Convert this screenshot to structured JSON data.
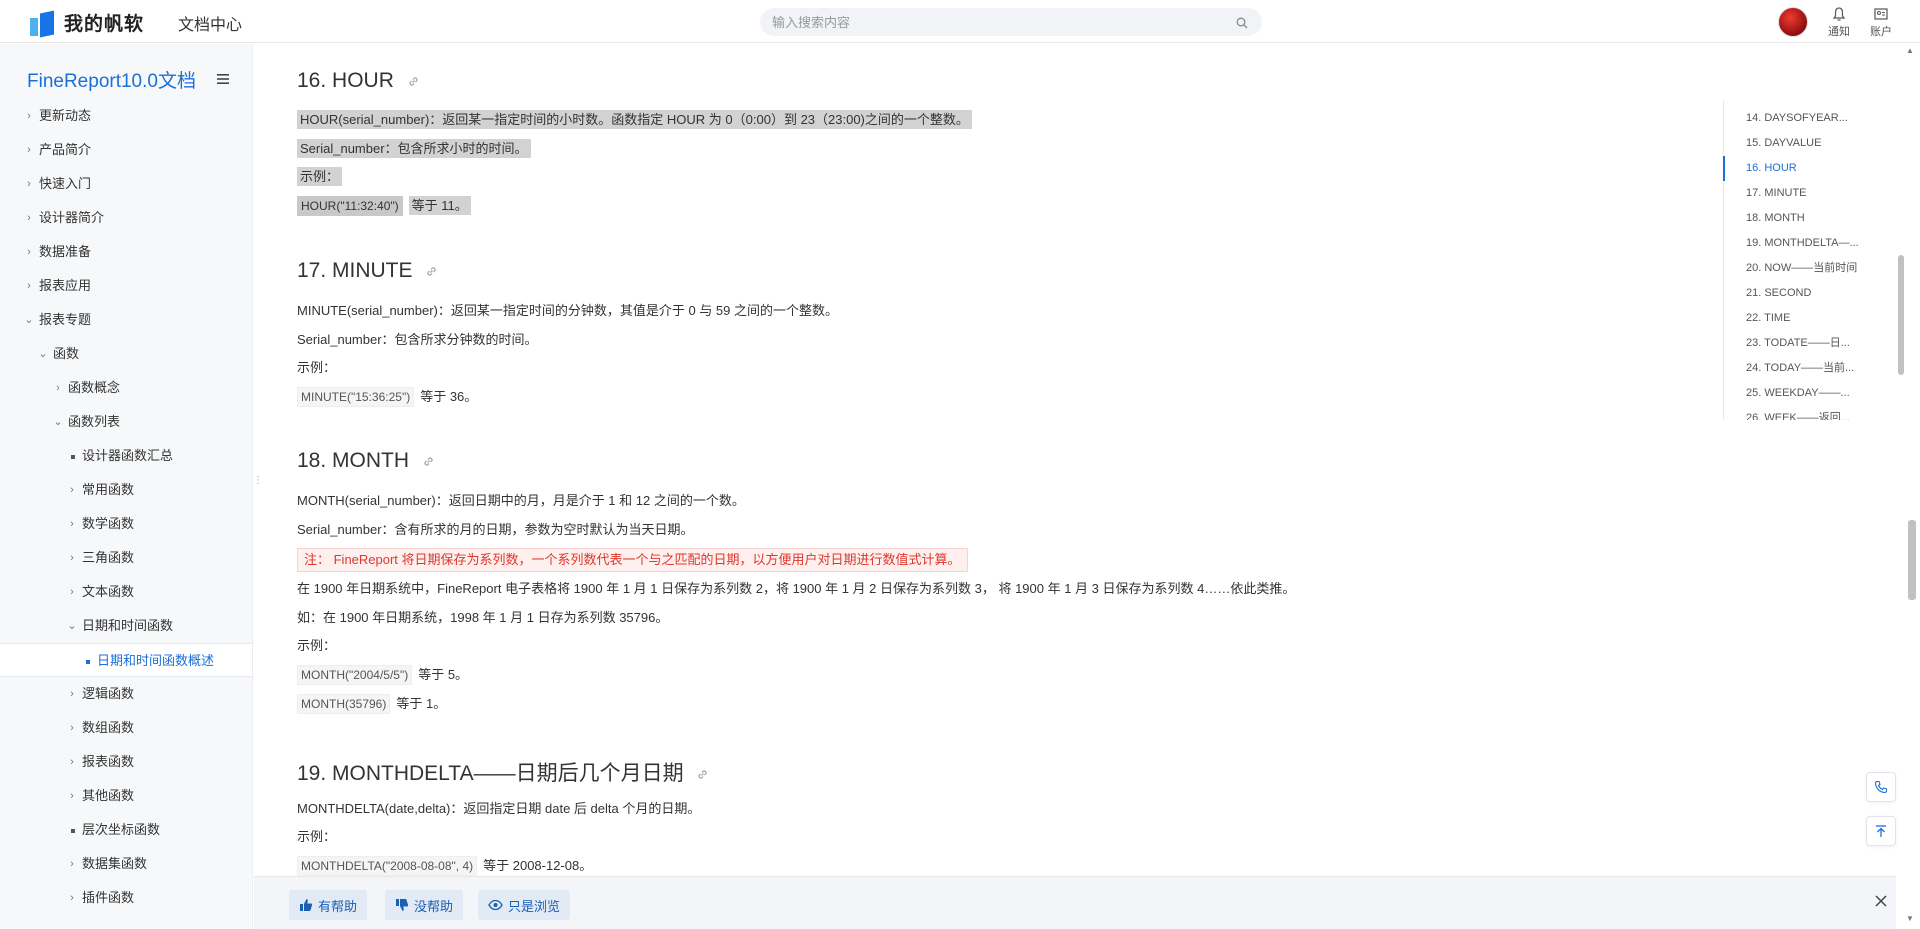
{
  "header": {
    "brand": "我的帆软",
    "section": "文档中心",
    "search_placeholder": "输入搜索内容",
    "notify_label": "通知",
    "account_label": "账户"
  },
  "sidebar": {
    "title": "FineReport10.0文档",
    "items": [
      {
        "label": "更新动态"
      },
      {
        "label": "产品简介"
      },
      {
        "label": "快速入门"
      },
      {
        "label": "设计器简介"
      },
      {
        "label": "数据准备"
      },
      {
        "label": "报表应用"
      },
      {
        "label": "报表专题"
      },
      {
        "label": "函数"
      },
      {
        "label": "函数概念"
      },
      {
        "label": "函数列表"
      },
      {
        "label": "设计器函数汇总"
      },
      {
        "label": "常用函数"
      },
      {
        "label": "数学函数"
      },
      {
        "label": "三角函数"
      },
      {
        "label": "文本函数"
      },
      {
        "label": "日期和时间函数"
      },
      {
        "label": "日期和时间函数概述"
      },
      {
        "label": "逻辑函数"
      },
      {
        "label": "数组函数"
      },
      {
        "label": "报表函数"
      },
      {
        "label": "其他函数"
      },
      {
        "label": "层次坐标函数"
      },
      {
        "label": "数据集函数"
      },
      {
        "label": "插件函数"
      }
    ]
  },
  "content": {
    "hour": {
      "title": "16. HOUR",
      "desc": "HOUR(serial_number)：返回某一指定时间的小时数。函数指定 HOUR 为 0（0:00）到 23（23:00)之间的一个整数。",
      "param": "Serial_number：包含所求小时的时间。",
      "example_label": "示例：",
      "ex1_code": "HOUR(\"11:32:40\")",
      "ex1_result": "等于 11。"
    },
    "minute": {
      "title": "17. MINUTE",
      "desc": "MINUTE(serial_number)：返回某一指定时间的分钟数，其值是介于 0 与 59 之间的一个整数。",
      "param": "Serial_number：包含所求分钟数的时间。",
      "example_label": "示例：",
      "ex1_code": "MINUTE(\"15:36:25\")",
      "ex1_result": "等于 36。"
    },
    "month": {
      "title": "18. MONTH",
      "desc": "MONTH(serial_number)：返回日期中的月，月是介于 1 和 12 之间的一个数。",
      "param": "Serial_number：含有所求的月的日期，参数为空时默认为当天日期。",
      "note": "注：  FineReport 将日期保存为系列数，一个系列数代表一个与之匹配的日期，以方便用户对日期进行数值式计算。",
      "para1": "在 1900 年日期系统中，FineReport 电子表格将 1900 年 1 月 1 日保存为系列数 2，将 1900 年 1 月 2 日保存为系列数 3，  将 1900 年 1 月 3 日保存为系列数 4……依此类推。",
      "para2": "如：在 1900 年日期系统，1998 年 1 月 1 日存为系列数 35796。",
      "example_label": "示例：",
      "ex1_code": "MONTH(\"2004/5/5\")",
      "ex1_result": "等于 5。",
      "ex2_code": "MONTH(35796)",
      "ex2_result": "等于 1。"
    },
    "monthdelta": {
      "title": "19. MONTHDELTA——日期后几个月日期",
      "desc": "MONTHDELTA(date,delta)：返回指定日期 date 后 delta 个月的日期。",
      "example_label": "示例：",
      "ex1_code": "MONTHDELTA(\"2008-08-08\", 4)",
      "ex1_result": "等于 2008-12-08。"
    }
  },
  "toc": {
    "items": [
      {
        "label": "14. DAYSOFYEAR..."
      },
      {
        "label": "15. DAYVALUE"
      },
      {
        "label": "16. HOUR"
      },
      {
        "label": "17. MINUTE"
      },
      {
        "label": "18. MONTH"
      },
      {
        "label": "19. MONTHDELTA—..."
      },
      {
        "label": "20. NOW——当前时间"
      },
      {
        "label": "21. SECOND"
      },
      {
        "label": "22. TIME"
      },
      {
        "label": "23. TODATE——日..."
      },
      {
        "label": "24. TODAY——当前..."
      },
      {
        "label": "25. WEEKDAY——..."
      },
      {
        "label": "26. WEEK——返回..."
      }
    ],
    "active_index": 2
  },
  "feedback": {
    "helpful": "有帮助",
    "not_helpful": "没帮助",
    "just_browsing": "只是浏览"
  },
  "colors": {
    "accent": "#1a6fd8",
    "note_red": "#e0362c",
    "highlight": "#d2d2d2"
  }
}
